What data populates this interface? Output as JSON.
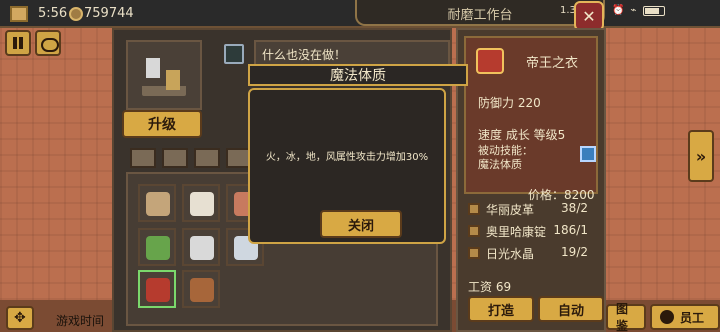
{
  "status_bar": {
    "time": "5:56",
    "money": "759744",
    "network": "1.3K/s"
  },
  "header": {
    "title": "耐磨工作台"
  },
  "workbench": {
    "status_text": "什么也没在做！",
    "upgrade_label": "升级"
  },
  "item_info": {
    "name": "帝王之衣",
    "defense": "防御力 220",
    "stats": "速度  成长  等级5",
    "skill_line1": "被动技能：",
    "skill_line2": "魔法体质",
    "price": "价格：8200"
  },
  "resources": [
    {
      "name": "华丽皮革",
      "count": "38/2"
    },
    {
      "name": "奥里哈康锭",
      "count": "186/1"
    },
    {
      "name": "日光水晶",
      "count": "19/2"
    }
  ],
  "wage": "工资 69",
  "actions": {
    "craft": "打造",
    "auto": "自动"
  },
  "bottom_buttons": {
    "left": "图鉴",
    "right": "员工"
  },
  "bottom_left": {
    "game_time_label": "游戏时间"
  },
  "modal": {
    "title": "魔法体质",
    "text": "火，冰，地，风属性攻击力增加30%",
    "close": "关闭"
  },
  "colors": {
    "accent_gold": "#d8a944",
    "panel_dark": "#3a332c",
    "modal_border": "#cfa445",
    "selected_slot": "#7bd86c"
  },
  "icons": {
    "settings": "crossed-tools-icon",
    "arrow": "double-chevron-right-icon",
    "move": "move-icon"
  }
}
